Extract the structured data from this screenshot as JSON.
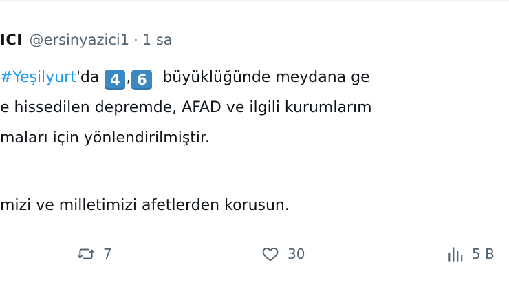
{
  "tweet": {
    "author_name_partial": "ICI",
    "handle": "@ersinyazici1",
    "separator": "·",
    "time": "1 sa",
    "line1": {
      "hashtag": "#Yeşilyurt",
      "suffix_da": "'da",
      "keycap_1": "4",
      "comma": ",",
      "keycap_2": "6",
      "rest": "büyüklüğünde meydana ge"
    },
    "line2": "e hissedilen depremde, AFAD ve ilgili kurumlarım",
    "line3": "maları için yönlendirilmiştir.",
    "line4": "mizi ve milletimizi afetlerden korusun."
  },
  "actions": {
    "retweet_icon": "retweet-icon",
    "retweet_count": "7",
    "like_icon": "heart-icon",
    "like_count": "30",
    "views_icon": "bar-chart-icon",
    "views_count": "5 B"
  },
  "colors": {
    "text": "#0f1419",
    "secondary": "#536471",
    "link": "#1d9bf0",
    "keycap": "#3b88c3"
  }
}
